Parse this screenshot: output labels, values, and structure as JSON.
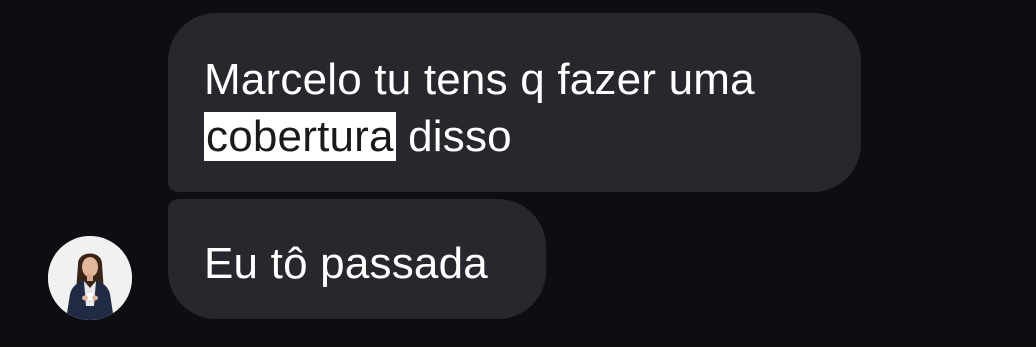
{
  "chat": {
    "messages": [
      {
        "line1": "Marcelo tu tens q fazer uma",
        "line2_highlight": "cobertura",
        "line2_rest": " disso"
      },
      {
        "text": "Eu tô passada"
      }
    ],
    "avatar": {
      "icon": "contact-avatar-photo"
    }
  },
  "colors": {
    "background": "#0c0e12",
    "bubble": "#26282d",
    "text": "#ffffff",
    "highlight": "#ffffff"
  }
}
